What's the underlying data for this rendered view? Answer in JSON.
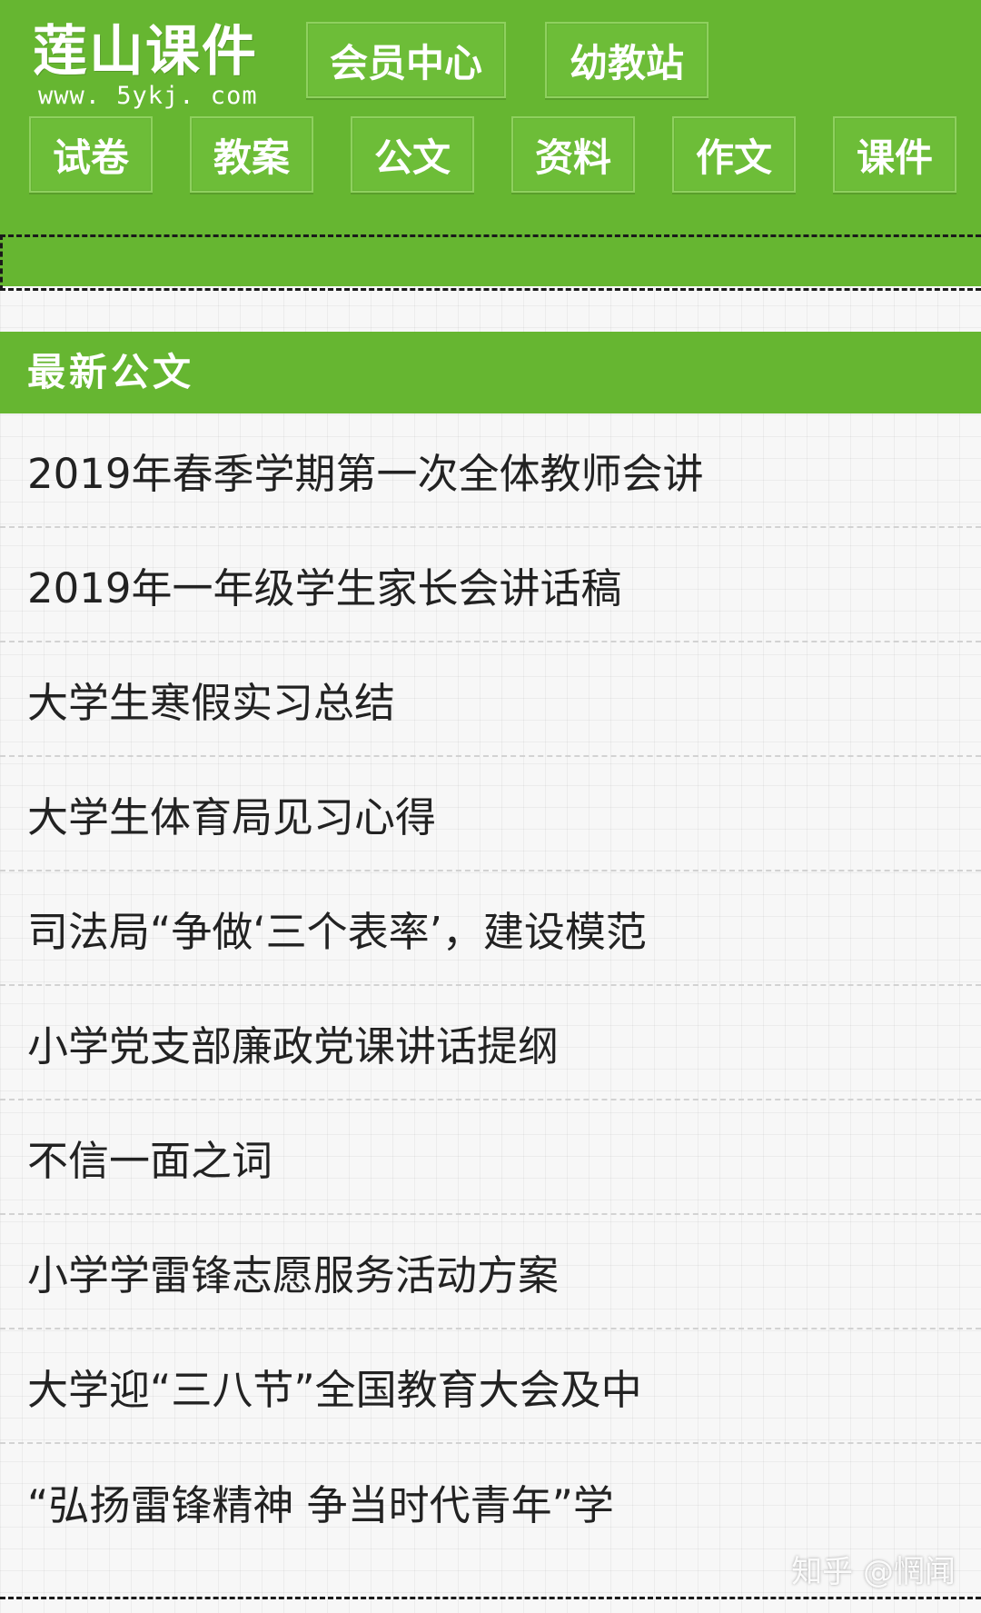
{
  "header": {
    "logo_title": "莲山课件",
    "logo_url": "www. 5ykj. com",
    "top_buttons": [
      "会员中心",
      "幼教站"
    ],
    "nav_buttons": [
      "试卷",
      "教案",
      "公文",
      "资料",
      "作文",
      "课件"
    ]
  },
  "section": {
    "title": "最新公文"
  },
  "articles": [
    "2019年春季学期第一次全体教师会讲",
    "2019年一年级学生家长会讲话稿",
    "大学生寒假实习总结",
    "大学生体育局见习心得",
    "司法局“争做‘三个表率’，建设模范",
    "小学党支部廉政党课讲话提纲",
    "不信一面之词",
    "小学学雷锋志愿服务活动方案",
    "大学迎“三八节”全国教育大会及中",
    "“弘扬雷锋精神 争当时代青年”学"
  ],
  "watermark": "知乎 @惘闻",
  "colors": {
    "brand_green": "#66b631",
    "text": "#222222"
  }
}
